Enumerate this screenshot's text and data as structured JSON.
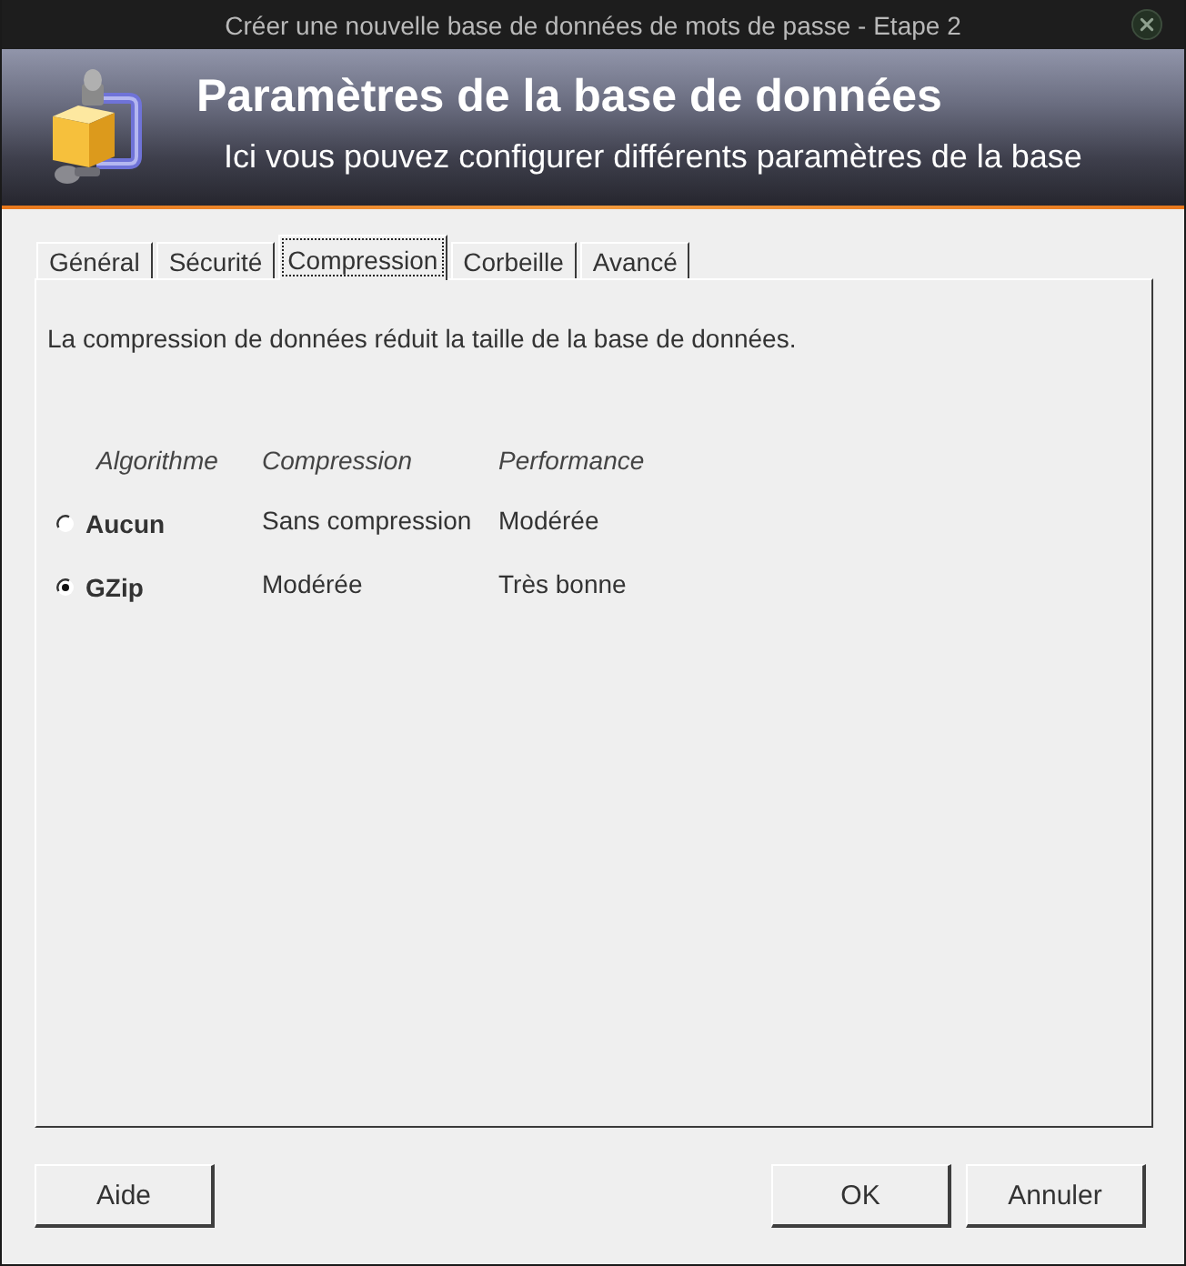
{
  "window": {
    "title": "Créer une nouvelle base de données de mots de passe - Etape 2"
  },
  "header": {
    "title": "Paramètres de la base de données",
    "subtitle": "Ici vous pouvez configurer différents paramètres de la base"
  },
  "tabs": [
    {
      "label": "Général",
      "selected": false
    },
    {
      "label": "Sécurité",
      "selected": false
    },
    {
      "label": "Compression",
      "selected": true
    },
    {
      "label": "Corbeille",
      "selected": false
    },
    {
      "label": "Avancé",
      "selected": false
    }
  ],
  "panel": {
    "description": "La compression de données réduit la taille de la base de données.",
    "table": {
      "columns": [
        "Algorithme",
        "Compression",
        "Performance"
      ],
      "rows": [
        {
          "algorithm": "Aucun",
          "compression": "Sans compression",
          "performance": "Modérée",
          "selected": false
        },
        {
          "algorithm": "GZip",
          "compression": "Modérée",
          "performance": "Très bonne",
          "selected": true
        }
      ]
    }
  },
  "footer": {
    "left_buttons": [
      {
        "label": "Aide"
      }
    ],
    "right_buttons": [
      {
        "label": "OK"
      },
      {
        "label": "Annuler"
      }
    ]
  }
}
